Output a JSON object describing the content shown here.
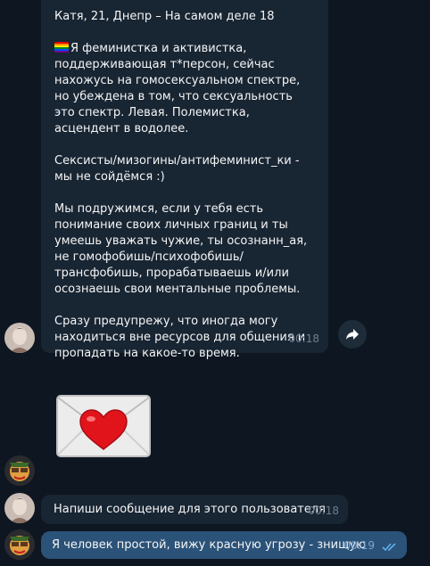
{
  "profile_message": {
    "header": "Катя, 21, Днепр – На самом деле 18",
    "paragraph1": "Я феминистка и активистка, поддерживающая т*персон, сейчас нахожусь на гомосексуальном спектре, но убеждена в том, что сексуальность это спектр. Левая. Полемистка, асцендент в водолее.",
    "paragraph2": "Сексисты/мизогины/антифеминист_ки - мы не сойдёмся :)",
    "paragraph3": "Мы подружимся, если у тебя есть понимание своих личных границ и ты умеешь уважать чужие, ты осознанн_ая, не гомофобишь/психофобишь/трансфобишь, прорабатываешь и/или осознаешь свои ментальные проблемы.",
    "paragraph4": "Сразу предупрежу, что иногда могу находиться вне ресурсов для общения и пропадать на какое-то время.",
    "time": "00:18"
  },
  "placeholder_message": {
    "text": "Напиши сообщение для этого пользователя",
    "time": "00:18"
  },
  "outgoing_message": {
    "text": "Я человек простой, вижу красную угрозу - знищую",
    "time": "00:19"
  },
  "icons": {
    "forward": "forward-arrow-icon",
    "sticker": "envelope-heart-sticker",
    "read_status": "double-check-icon",
    "flag": "rainbow-flag-emoji"
  },
  "colors": {
    "background": "#0e1621",
    "incoming_bubble": "#182533",
    "outgoing_bubble": "#2b5278",
    "read_check": "#5fb0f0"
  }
}
